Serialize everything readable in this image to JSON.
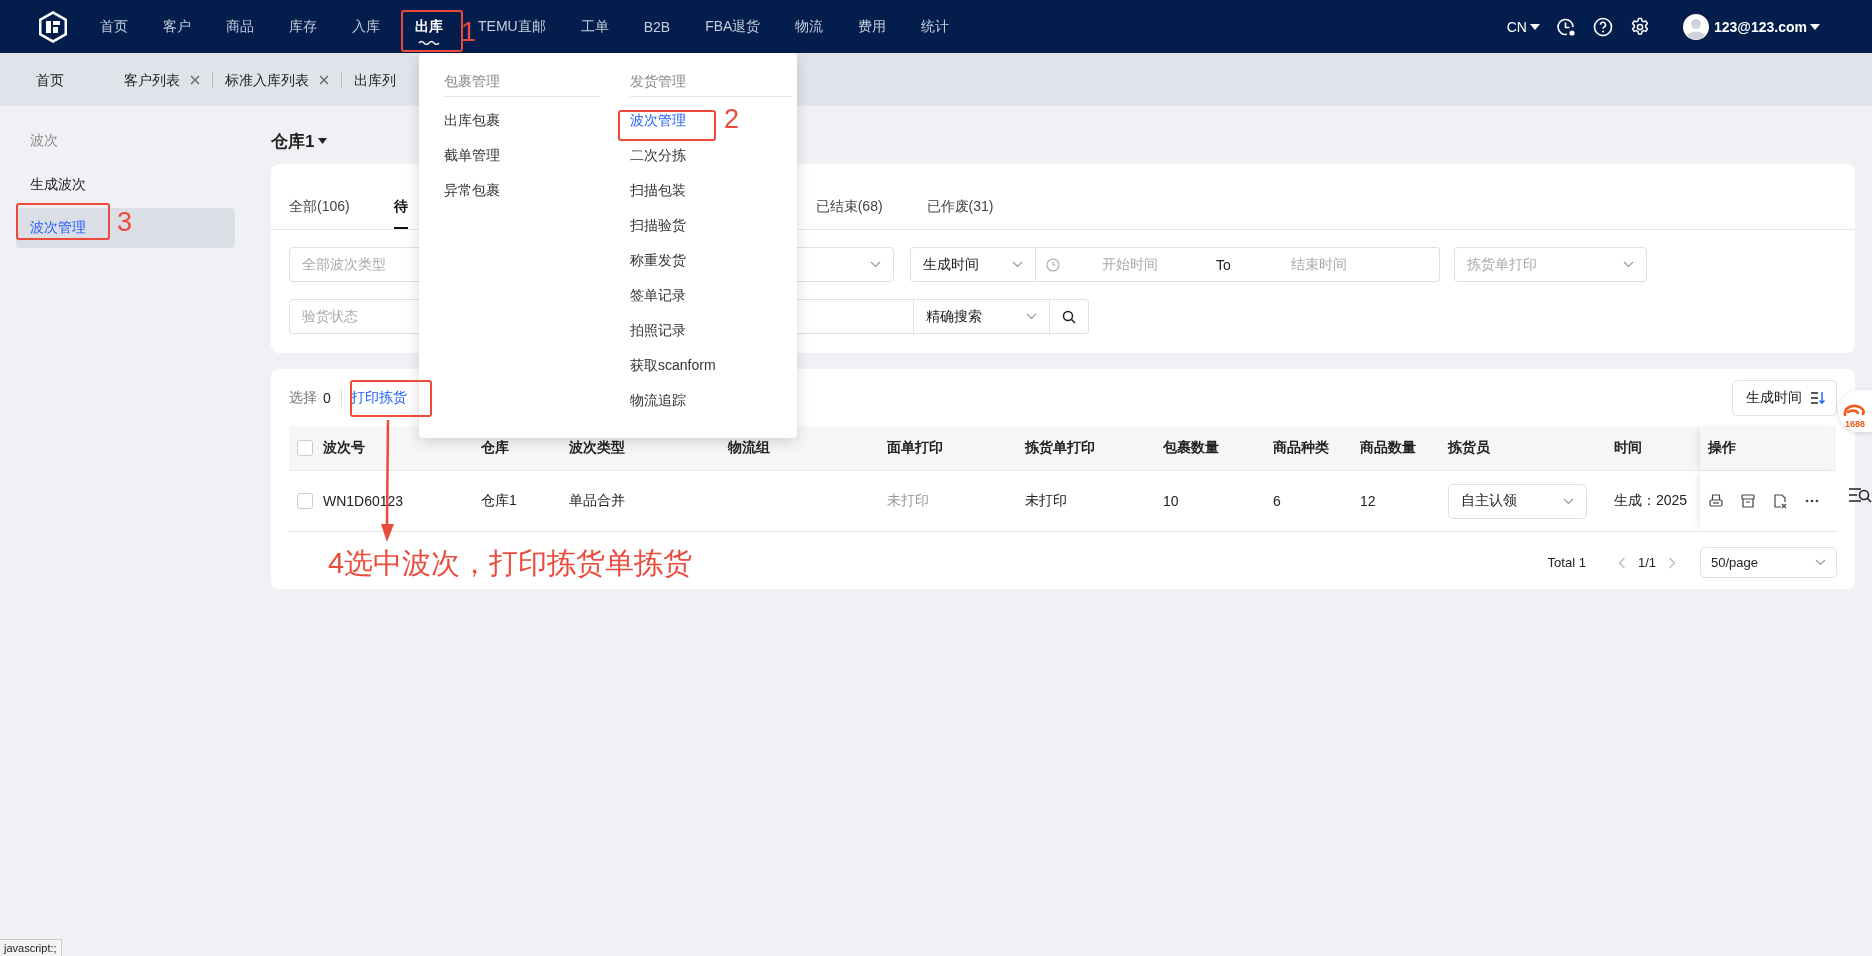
{
  "top_nav": {
    "items": [
      {
        "label": "首页",
        "selected": false
      },
      {
        "label": "客户",
        "selected": false
      },
      {
        "label": "商品",
        "selected": false
      },
      {
        "label": "库存",
        "selected": false
      },
      {
        "label": "入库",
        "selected": false
      },
      {
        "label": "出库",
        "selected": true
      },
      {
        "label": "TEMU直邮",
        "selected": false
      },
      {
        "label": "工单",
        "selected": false
      },
      {
        "label": "B2B",
        "selected": false
      },
      {
        "label": "FBA退货",
        "selected": false
      },
      {
        "label": "物流",
        "selected": false
      },
      {
        "label": "费用",
        "selected": false
      },
      {
        "label": "统计",
        "selected": false
      }
    ],
    "language": "CN",
    "user": "123@123.com"
  },
  "page_tabs": [
    {
      "label": "首页",
      "closable": false
    },
    {
      "label": "客户列表",
      "closable": true
    },
    {
      "label": "标准入库列表",
      "closable": true
    },
    {
      "label": "出库列",
      "closable": false
    }
  ],
  "sidebar": {
    "heading": "波次",
    "items": [
      {
        "label": "生成波次",
        "selected": false
      },
      {
        "label": "波次管理",
        "selected": true
      }
    ]
  },
  "warehouse_selector": "仓库1",
  "status_tabs": [
    {
      "label": "全部(106)",
      "selected": false
    },
    {
      "label": "待",
      "selected": true
    },
    {
      "label": "已结束(68)",
      "selected": false
    },
    {
      "label": "已作废(31)",
      "selected": false
    }
  ],
  "filters": [
    [
      {
        "kind": "select",
        "placeholder": "全部波次类型"
      },
      {
        "kind": "select"
      },
      {
        "kind": "select",
        "value": "生成时间"
      },
      {
        "kind": "daterange",
        "start_placeholder": "开始时间",
        "separator": "To",
        "end_placeholder": "结束时间"
      },
      {
        "kind": "select",
        "placeholder": "拣货单打印"
      }
    ],
    [
      {
        "kind": "select",
        "placeholder": "验货状态"
      },
      {
        "kind": "input"
      },
      {
        "kind": "select",
        "value": "精确搜索"
      },
      {
        "kind": "search"
      }
    ]
  ],
  "toolbar": {
    "selected_label": "选择",
    "selected_count": "0",
    "print_button": "打印拣货",
    "sort_button": "生成时间"
  },
  "table": {
    "select_all_checked": false,
    "columns": [
      "波次号",
      "仓库",
      "波次类型",
      "物流组",
      "面单打印",
      "拣货单打印",
      "包裹数量",
      "商品种类",
      "商品数量",
      "拣货员",
      "时间",
      "操作"
    ],
    "rows": [
      {
        "checked": false,
        "batch_no": "WN1D60123",
        "warehouse": "仓库1",
        "batch_type": "单品合并",
        "waybill_print": {
          "text": "未打印",
          "dimmed": true
        },
        "picklist_print": {
          "text": "未打印",
          "dimmed": false
        },
        "parcel_count": "10",
        "item_types": "6",
        "item_count": "12",
        "picker": "自主认领",
        "time": "生成：2025"
      }
    ]
  },
  "pagination": {
    "total": "Total 1",
    "page": "1/1",
    "page_size": "50/page"
  },
  "menu": {
    "columns": [
      {
        "heading": "包裹管理",
        "items": [
          {
            "label": "出库包裹",
            "selected": false
          },
          {
            "label": "截单管理",
            "selected": false
          },
          {
            "label": "异常包裹",
            "selected": false
          }
        ]
      },
      {
        "heading": "发货管理",
        "items": [
          {
            "label": "波次管理",
            "selected": true
          },
          {
            "label": "二次分拣",
            "selected": false
          },
          {
            "label": "扫描包装",
            "selected": false
          },
          {
            "label": "扫描验货",
            "selected": false
          },
          {
            "label": "称重发货",
            "selected": false
          },
          {
            "label": "签单记录",
            "selected": false
          },
          {
            "label": "拍照记录",
            "selected": false
          },
          {
            "label": "获取scanform",
            "selected": false
          },
          {
            "label": "物流追踪",
            "selected": false
          }
        ]
      }
    ]
  },
  "annotations": {
    "step_labels": [
      "1",
      "2",
      "3"
    ],
    "note": "4选中波次，打印拣货单拣货"
  },
  "float_badge": "1688",
  "status_url": "javascript:;"
}
